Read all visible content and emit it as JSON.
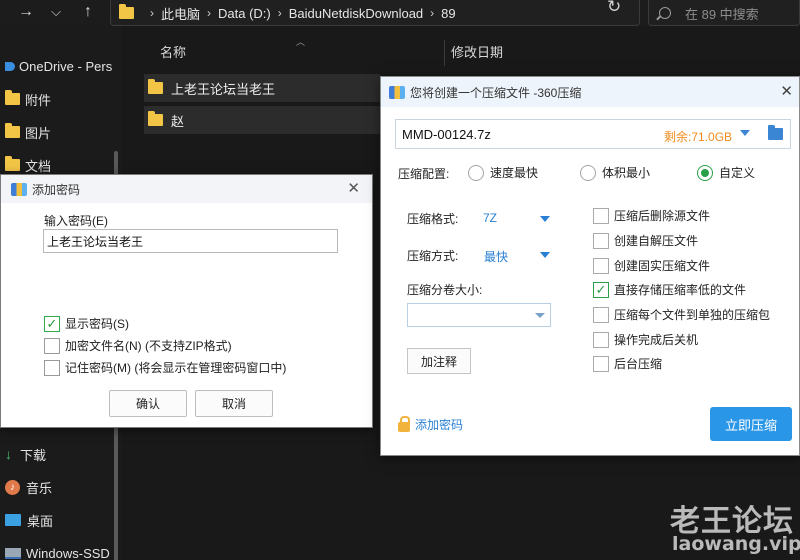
{
  "explorer": {
    "breadcrumb": [
      "此电脑",
      "Data (D:)",
      "BaiduNetdiskDownload",
      "89"
    ],
    "search_placeholder": "在 89 中搜索",
    "columns": {
      "name": "名称",
      "modified": "修改日期"
    },
    "files": [
      {
        "name": "上老王论坛当老王",
        "type": "folder"
      },
      {
        "name": "赵",
        "type": "folder"
      }
    ]
  },
  "nav": {
    "items": [
      {
        "label": "OneDrive - Pers",
        "icon": "cloud-icon"
      },
      {
        "label": "附件",
        "icon": "folder-icon"
      },
      {
        "label": "图片",
        "icon": "folder-icon"
      },
      {
        "label": "文档",
        "icon": "folder-icon"
      },
      {
        "label": "下载",
        "icon": "download-icon"
      },
      {
        "label": "音乐",
        "icon": "music-icon"
      },
      {
        "label": "桌面",
        "icon": "desktop-icon"
      },
      {
        "label": "Windows-SSD",
        "icon": "drive-icon"
      }
    ]
  },
  "password_dialog": {
    "title": "添加密码",
    "input_label": "输入密码(E)",
    "password_value": "上老王论坛当老王",
    "show_password": {
      "label": "显示密码(S)",
      "checked": true
    },
    "encrypt_names": {
      "label": "加密文件名(N) (不支持ZIP格式)",
      "checked": false
    },
    "remember": {
      "label": "记住密码(M) (将会显示在管理密码窗口中)",
      "checked": false
    },
    "ok": "确认",
    "cancel": "取消"
  },
  "zip_dialog": {
    "title": "您将创建一个压缩文件 -360压缩",
    "filename": "MMD-00124.7z",
    "free_space": "剩余:71.0GB",
    "config_label": "压缩配置:",
    "config_options": [
      {
        "label": "速度最快",
        "selected": false
      },
      {
        "label": "体积最小",
        "selected": false
      },
      {
        "label": "自定义",
        "selected": true
      }
    ],
    "format_label": "压缩格式:",
    "format_value": "7Z",
    "method_label": "压缩方式:",
    "method_value": "最快",
    "volume_label": "压缩分卷大小:",
    "volume_value": "",
    "comment_button": "加注释",
    "options": [
      {
        "label": "压缩后删除源文件",
        "checked": false
      },
      {
        "label": "创建自解压文件",
        "checked": false
      },
      {
        "label": "创建固实压缩文件",
        "checked": false
      },
      {
        "label": "直接存储压缩率低的文件",
        "checked": true
      },
      {
        "label": "压缩每个文件到单独的压缩包",
        "checked": false
      },
      {
        "label": "操作完成后关机",
        "checked": false
      },
      {
        "label": "后台压缩",
        "checked": false
      }
    ],
    "add_password": "添加密码",
    "start_button": "立即压缩"
  },
  "watermark": {
    "title": "老王论坛",
    "url": "laowang.vip"
  },
  "colors": {
    "accent_blue": "#2a96e8",
    "check_green": "#2aa04a",
    "free_space_orange": "#f08c1e",
    "folder_yellow": "#f3c547"
  }
}
